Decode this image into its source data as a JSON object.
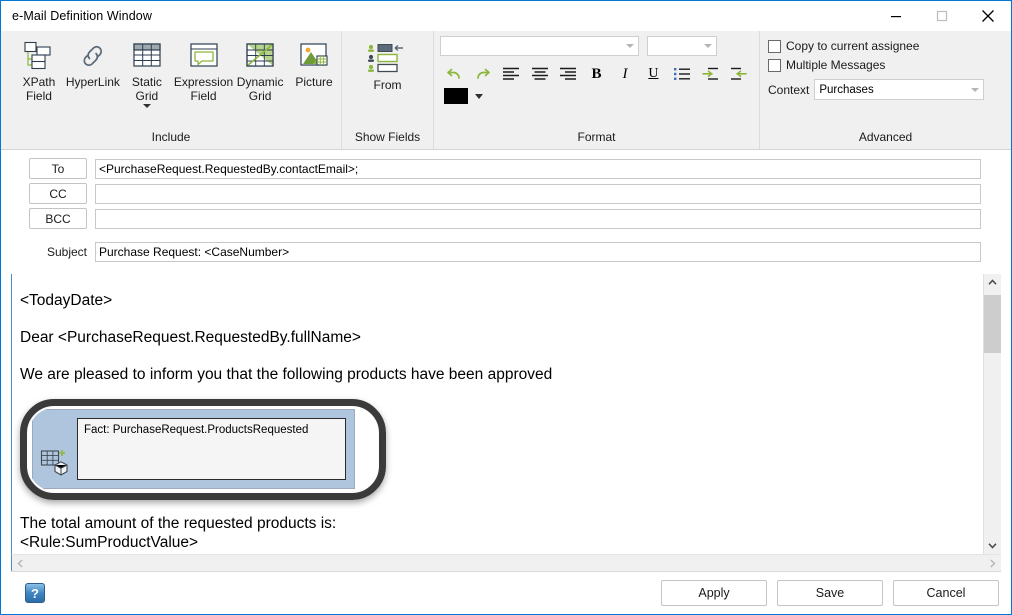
{
  "window": {
    "title": "e-Mail Definition Window",
    "controls": {
      "minimize": "minimize-icon",
      "maximize": "maximize-icon",
      "close": "close-icon"
    }
  },
  "ribbon": {
    "groups": [
      {
        "name": "Include",
        "label": "Include",
        "buttons": [
          {
            "label": "XPath\nField",
            "icon": "xpath-field-icon",
            "has_dropdown": false
          },
          {
            "label": "HyperLink",
            "icon": "hyperlink-icon",
            "has_dropdown": false
          },
          {
            "label": "Static\nGrid",
            "icon": "static-grid-icon",
            "has_dropdown": true
          },
          {
            "label": "Expression\nField",
            "icon": "expression-field-icon",
            "has_dropdown": false
          },
          {
            "label": "Dynamic\nGrid",
            "icon": "dynamic-grid-icon",
            "has_dropdown": false
          },
          {
            "label": "Picture",
            "icon": "picture-icon",
            "has_dropdown": false
          }
        ]
      },
      {
        "name": "ShowFields",
        "label": "Show Fields",
        "buttons": [
          {
            "label": "From",
            "icon": "from-field-icon",
            "has_dropdown": false
          }
        ]
      },
      {
        "name": "Format",
        "label": "Format",
        "font_name": {
          "value": "",
          "placeholder": ""
        },
        "font_size": {
          "value": "",
          "placeholder": ""
        },
        "tools": [
          {
            "name": "undo",
            "icon": "undo-icon",
            "glyph": ""
          },
          {
            "name": "redo",
            "icon": "redo-icon",
            "glyph": ""
          },
          {
            "name": "align-left",
            "icon": "align-left-icon",
            "glyph": ""
          },
          {
            "name": "align-center",
            "icon": "align-center-icon",
            "glyph": ""
          },
          {
            "name": "align-right",
            "icon": "align-right-icon",
            "glyph": ""
          },
          {
            "name": "bold",
            "icon": "bold-icon",
            "glyph": "B"
          },
          {
            "name": "italic",
            "icon": "italic-icon",
            "glyph": "I"
          },
          {
            "name": "underline",
            "icon": "underline-icon",
            "glyph": "U"
          },
          {
            "name": "bullet-list",
            "icon": "bullet-list-icon",
            "glyph": ""
          },
          {
            "name": "increase-indent",
            "icon": "increase-indent-icon",
            "glyph": ""
          },
          {
            "name": "decrease-indent",
            "icon": "decrease-indent-icon",
            "glyph": ""
          }
        ],
        "text_color": "#000000"
      },
      {
        "name": "Advanced",
        "label": "Advanced",
        "checkboxes": [
          {
            "label": "Copy to current assignee",
            "checked": false
          },
          {
            "label": "Multiple Messages",
            "checked": false
          }
        ],
        "context": {
          "label": "Context",
          "value": "Purchases"
        }
      }
    ]
  },
  "form": {
    "rows": [
      {
        "button": "To",
        "value": "<PurchaseRequest.RequestedBy.contactEmail>;"
      },
      {
        "button": "CC",
        "value": ""
      },
      {
        "button": "BCC",
        "value": ""
      }
    ],
    "subject": {
      "label": "Subject",
      "value": "Purchase Request: <CaseNumber>"
    }
  },
  "body": {
    "lines_before": [
      "<TodayDate>",
      "Dear <PurchaseRequest.RequestedBy.fullName>",
      "We are pleased to inform you that the following products have been approved"
    ],
    "grid_object": {
      "selected": true,
      "icon": "dynamic-grid-object-icon",
      "text": "Fact: PurchaseRequest.ProductsRequested"
    },
    "lines_after": [
      "The total amount of the requested products is:",
      "<Rule:SumProductValue>"
    ]
  },
  "scrollbars": {
    "vertical": {
      "up": "chevron-up-icon",
      "down": "chevron-down-icon"
    },
    "horizontal": {
      "left": "chevron-left-icon",
      "right": "chevron-right-icon"
    }
  },
  "footer": {
    "help_icon": "help-icon",
    "buttons": [
      {
        "label": "Apply"
      },
      {
        "label": "Save"
      },
      {
        "label": "Cancel"
      }
    ]
  },
  "colors": {
    "window_border": "#0078d7",
    "ribbon_bg": "#f0f0f0",
    "selection_bg": "#afc4dd",
    "accent_green": "#76a832"
  }
}
